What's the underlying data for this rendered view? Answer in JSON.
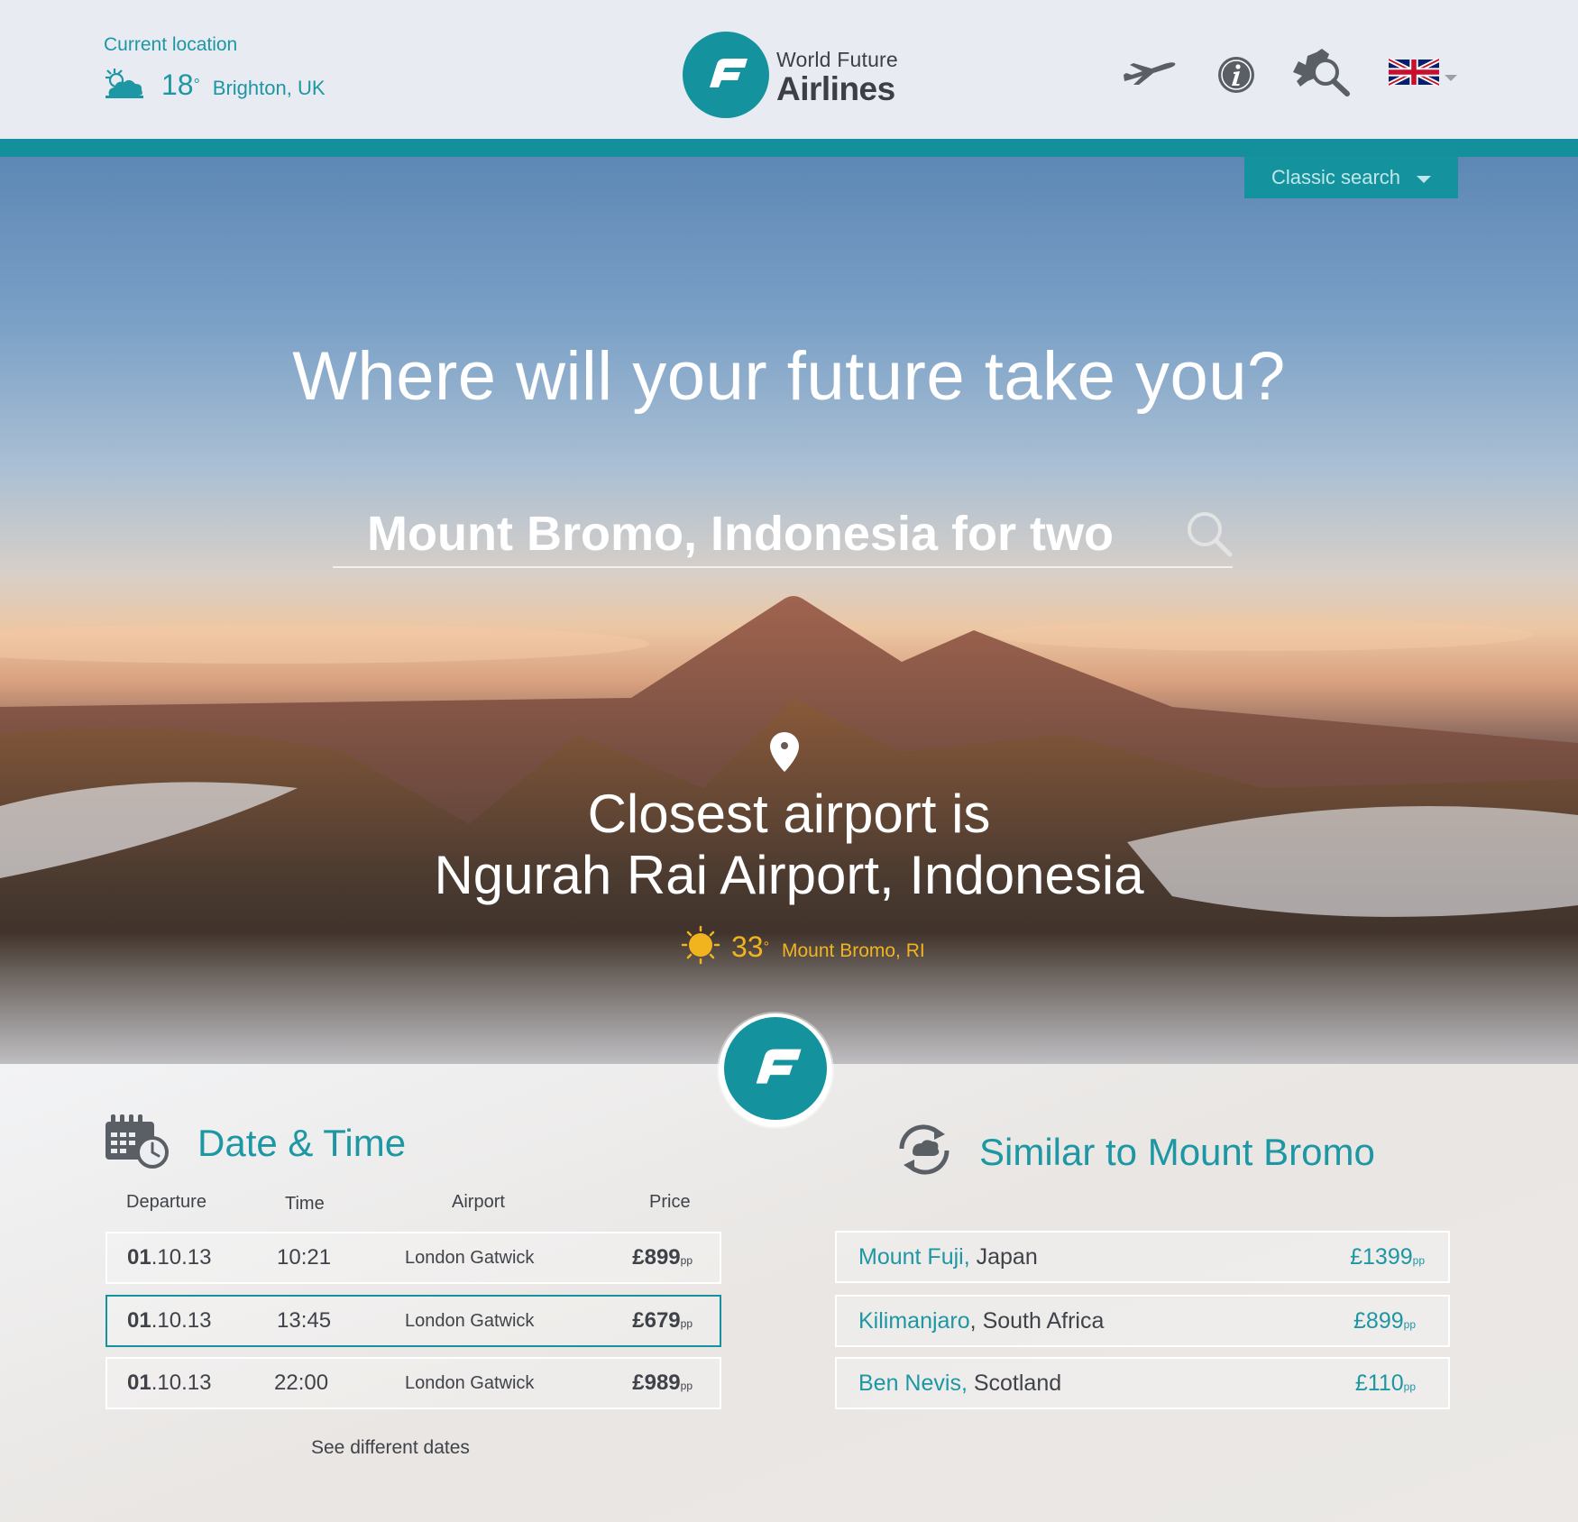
{
  "header": {
    "current_location_label": "Current location",
    "weather_icon": "cloud-sun-icon",
    "temperature": "18",
    "degree_symbol": "°",
    "city": "Brighton, UK",
    "logo_top": "World Future",
    "logo_bottom": "Airlines",
    "nav_icons": [
      "airplane-icon",
      "info-icon",
      "map-search-icon",
      "uk-flag-icon"
    ],
    "colors": {
      "accent": "#14939e",
      "header_bg": "#e8ebf2"
    }
  },
  "hero": {
    "classic_search_label": "Classic search",
    "title": "Where will your future take you?",
    "search_value": "Mount Bromo, Indonesia for two",
    "airport_line1": "Closest airport is",
    "airport_line2": "Ngurah Rai Airport, Indonesia",
    "dest_temperature": "33",
    "dest_degree_symbol": "°",
    "dest_city": "Mount Bromo, RI",
    "dest_weather_icon": "sun-icon",
    "dest_weather_color": "#f1b41e"
  },
  "dates": {
    "title": "Date & Time",
    "headers": {
      "departure": "Departure",
      "time": "Time",
      "airport": "Airport",
      "price": "Price"
    },
    "rows": [
      {
        "day": "01",
        "rest": ".10.13",
        "time": "10:21",
        "airport": "London Gatwick",
        "price": "£899",
        "unit": "pp",
        "selected": false
      },
      {
        "day": "01",
        "rest": ".10.13",
        "time": "13:45",
        "airport": "London Gatwick",
        "price": "£679",
        "unit": "pp",
        "selected": true
      },
      {
        "day": "01",
        "rest": ".10.13",
        "time": "22:00",
        "airport": "London Gatwick",
        "price": "£989",
        "unit": "pp",
        "selected": false
      }
    ],
    "see_different": "See different dates"
  },
  "similar": {
    "title": "Similar to Mount Bromo",
    "items": [
      {
        "place": "Mount Fuji,",
        "country": " Japan",
        "price": "£1399",
        "unit": "pp"
      },
      {
        "place": "Kilimanjaro",
        "country": ", South Africa",
        "price": "£899",
        "unit": "pp"
      },
      {
        "place": "Ben Nevis,",
        "country": " Scotland",
        "price": "£110",
        "unit": "pp"
      }
    ]
  }
}
